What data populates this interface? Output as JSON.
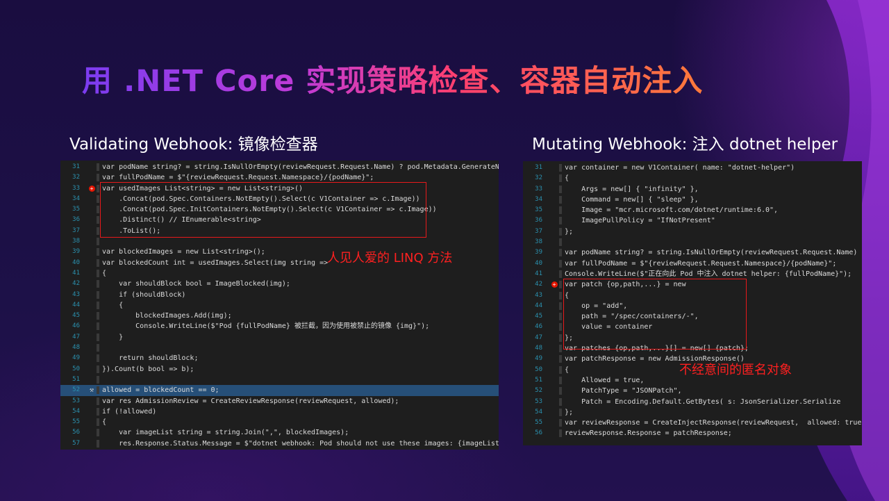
{
  "slide": {
    "title": "用 .NET Core 实现策略检查、容器自动注入"
  },
  "left": {
    "subtitle": "Validating Webhook: 镜像检查器",
    "annotation": "人见人爱的 LINQ 方法",
    "lines": [
      {
        "n": "31",
        "t": "var podName string? = string.IsNullOrEmpty(reviewRequest.Request.Name) ? pod.Metadata.GenerateName +"
      },
      {
        "n": "32",
        "t": "var fullPodName = $\"{reviewRequest.Request.Namespace}/{podName}\";"
      },
      {
        "n": "33",
        "t": "var usedImages List<string> = new List<string>()",
        "g": "bp"
      },
      {
        "n": "34",
        "t": "    .Concat(pod.Spec.Containers.NotEmpty().Select(c V1Container => c.Image))"
      },
      {
        "n": "35",
        "t": "    .Concat(pod.Spec.InitContainers.NotEmpty().Select(c V1Container => c.Image))"
      },
      {
        "n": "36",
        "t": "    .Distinct() // IEnumerable<string>"
      },
      {
        "n": "37",
        "t": "    .ToList();"
      },
      {
        "n": "38",
        "t": ""
      },
      {
        "n": "39",
        "t": "var blockedImages = new List<string>();"
      },
      {
        "n": "40",
        "t": "var blockedCount int = usedImages.Select(img string =>"
      },
      {
        "n": "41",
        "t": "{"
      },
      {
        "n": "42",
        "t": "    var shouldBlock bool = ImageBlocked(img);"
      },
      {
        "n": "43",
        "t": "    if (shouldBlock)"
      },
      {
        "n": "44",
        "t": "    {"
      },
      {
        "n": "45",
        "t": "        blockedImages.Add(img);"
      },
      {
        "n": "46",
        "t": "        Console.WriteLine($\"Pod {fullPodName} 被拦截，因为使用被禁止的镜像 {img}\");"
      },
      {
        "n": "47",
        "t": "    }"
      },
      {
        "n": "48",
        "t": ""
      },
      {
        "n": "49",
        "t": "    return shouldBlock;"
      },
      {
        "n": "50",
        "t": "}).Count(b bool => b);"
      },
      {
        "n": "51",
        "t": ""
      },
      {
        "n": "52",
        "t": "allowed = blockedCount == 0;",
        "g": "wrench",
        "hl": true
      },
      {
        "n": "53",
        "t": "var res AdmissionReview = CreateReviewResponse(reviewRequest, allowed);"
      },
      {
        "n": "54",
        "t": "if (!allowed)"
      },
      {
        "n": "55",
        "t": "{"
      },
      {
        "n": "56",
        "t": "    var imageList string = string.Join(\",\", blockedImages);"
      },
      {
        "n": "57",
        "t": "    res.Response.Status.Message = $\"dotnet webhook: Pod should not use these images: {imageList}\";"
      },
      {
        "n": "58",
        "t": "}"
      }
    ]
  },
  "right": {
    "subtitle": "Mutating Webhook: 注入 dotnet helper",
    "annotation": "不经意间的匿名对象",
    "lines": [
      {
        "n": "31",
        "t": "var container = new V1Container( name: \"dotnet-helper\")"
      },
      {
        "n": "32",
        "t": "{"
      },
      {
        "n": "33",
        "t": "    Args = new[] { \"infinity\" },"
      },
      {
        "n": "34",
        "t": "    Command = new[] { \"sleep\" },"
      },
      {
        "n": "35",
        "t": "    Image = \"mcr.microsoft.com/dotnet/runtime:6.0\","
      },
      {
        "n": "36",
        "t": "    ImagePullPolicy = \"IfNotPresent\""
      },
      {
        "n": "37",
        "t": "};"
      },
      {
        "n": "38",
        "t": ""
      },
      {
        "n": "39",
        "t": "var podName string? = string.IsNullOrEmpty(reviewRequest.Request.Name) ?"
      },
      {
        "n": "40",
        "t": "var fullPodName = $\"{reviewRequest.Request.Namespace}/{podName}\";"
      },
      {
        "n": "41",
        "t": "Console.WriteLine($\"正在向此 Pod 中注入 dotnet helper: {fullPodName}\");"
      },
      {
        "n": "42",
        "t": "var patch {op,path,...} = new",
        "g": "bp"
      },
      {
        "n": "43",
        "t": "{"
      },
      {
        "n": "44",
        "t": "    op = \"add\","
      },
      {
        "n": "45",
        "t": "    path = \"/spec/containers/-\","
      },
      {
        "n": "46",
        "t": "    value = container"
      },
      {
        "n": "47",
        "t": "};"
      },
      {
        "n": "48",
        "t": "var patches {op,path,...}[] = new[] {patch};"
      },
      {
        "n": "49",
        "t": "var patchResponse = new AdmissionResponse()"
      },
      {
        "n": "50",
        "t": "{"
      },
      {
        "n": "51",
        "t": "    Allowed = true,"
      },
      {
        "n": "52",
        "t": "    PatchType = \"JSONPatch\","
      },
      {
        "n": "53",
        "t": "    Patch = Encoding.Default.GetBytes( s: JsonSerializer.Serialize"
      },
      {
        "n": "54",
        "t": "};"
      },
      {
        "n": "55",
        "t": "var reviewResponse = CreateInjectResponse(reviewRequest,  allowed: true);"
      },
      {
        "n": "56",
        "t": "reviewResponse.Response = patchResponse;"
      }
    ]
  }
}
